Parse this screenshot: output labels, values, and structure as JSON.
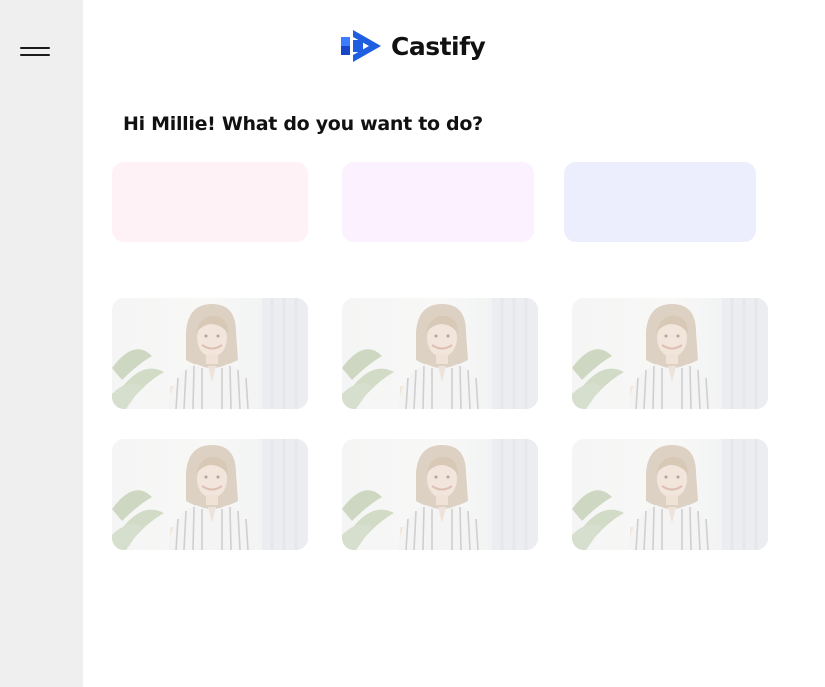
{
  "app": {
    "logo_text": "Castify",
    "brand_color": "#1f5ee0",
    "menu_icon": "hamburger-menu-icon"
  },
  "main": {
    "greeting": "Hi Millie! What do you want to do?",
    "action_cards": [
      {
        "color": "#fff2f7"
      },
      {
        "color": "#fcf1fe"
      },
      {
        "color": "#ecedfd"
      }
    ],
    "thumbnails": [
      {
        "image": "woman-portrait-image"
      },
      {
        "image": "woman-portrait-image"
      },
      {
        "image": "woman-portrait-image"
      },
      {
        "image": "woman-portrait-image"
      },
      {
        "image": "woman-portrait-image"
      },
      {
        "image": "woman-portrait-image"
      }
    ]
  }
}
